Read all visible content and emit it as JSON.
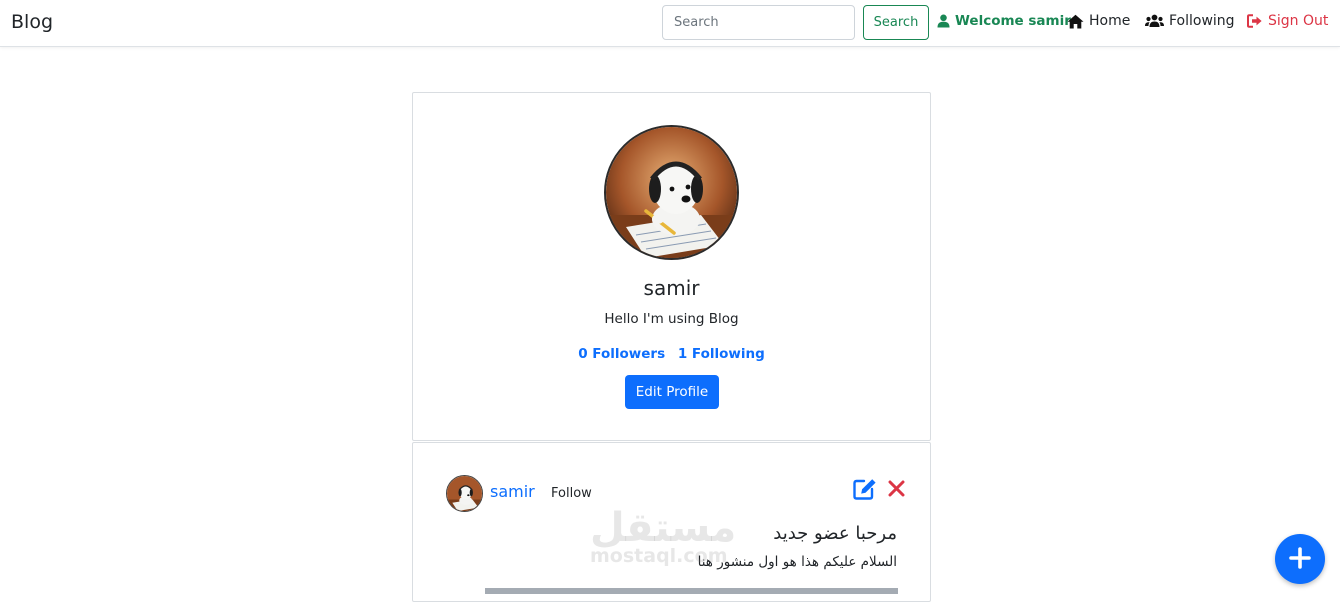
{
  "navbar": {
    "brand": "Blog",
    "search_placeholder": "Search",
    "search_button": "Search",
    "welcome_text": "Welcome samir",
    "home_label": "Home",
    "following_label": "Following",
    "signout_label": "Sign Out",
    "icons": [
      "user-icon",
      "home-icon",
      "users-icon",
      "sign-out-icon"
    ]
  },
  "profile": {
    "name": "samir",
    "bio": "Hello I'm using Blog",
    "followers": "0 Followers",
    "following": "1 Following",
    "edit_button": "Edit Profile"
  },
  "post": {
    "author": "samir",
    "follow_label": "Follow",
    "title": "مرحبا عضو جديد",
    "body": "السلام عليكم هذا هو اول منشور هنا",
    "icons": [
      "edit-icon",
      "delete-icon"
    ]
  },
  "watermark": {
    "arabic": "مستقل",
    "latin": "mostaql.com"
  },
  "colors": {
    "primary": "#0d6efd",
    "success": "#198754",
    "danger": "#dc3545"
  }
}
